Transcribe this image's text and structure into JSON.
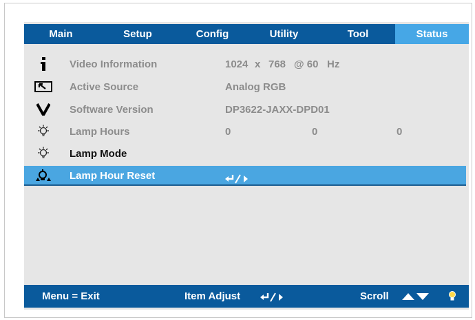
{
  "tabs": [
    {
      "label": "Main",
      "active": false
    },
    {
      "label": "Setup",
      "active": false
    },
    {
      "label": "Config",
      "active": false
    },
    {
      "label": "Utility",
      "active": false
    },
    {
      "label": "Tool",
      "active": false
    },
    {
      "label": "Status",
      "active": true
    }
  ],
  "rows": {
    "video": {
      "icon": "info-icon",
      "label": "Video Information",
      "width_value": "1024",
      "x_sep": "x",
      "height_value": "768",
      "rate": "@ 60",
      "unit": "Hz"
    },
    "source": {
      "icon": "source-icon",
      "label": "Active Source",
      "value": "Analog RGB"
    },
    "software": {
      "icon": "version-icon",
      "label": "Software Version",
      "value": "DP3622-JAXX-DPD01"
    },
    "lamp_hours": {
      "icon": "lamp-icon",
      "label": "Lamp Hours",
      "values": [
        "0",
        "0",
        "0"
      ]
    },
    "lamp_mode": {
      "icon": "lamp-icon",
      "label": "Lamp Mode"
    },
    "lamp_reset": {
      "icon": "lamp-reset-icon",
      "label": "Lamp Hour Reset",
      "value_icon": "enter-right-icon",
      "selected": true
    }
  },
  "footer": {
    "menu_exit": "Menu = Exit",
    "item_adjust": "Item Adjust",
    "scroll": "Scroll",
    "adjust_icon": "enter-right-icon",
    "scroll_icon": "up-down-arrows-icon",
    "lamp_icon": "lamp-icon"
  },
  "colors": {
    "bar": "#0a5a9c",
    "active_tab": "#46a7e6",
    "selected_row": "#4aa6e1",
    "panel": "#e6e6e6",
    "muted_text": "#8c8c8c"
  }
}
